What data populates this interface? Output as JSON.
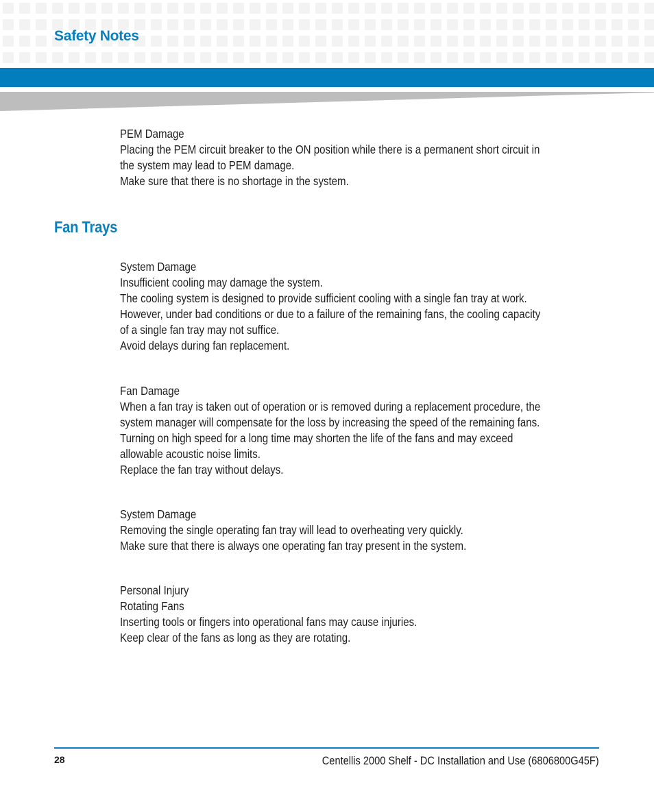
{
  "header": {
    "section_title": "Safety Notes",
    "accent_color": "#027dbd"
  },
  "pem_note": {
    "title": "PEM Damage",
    "lines": [
      "Placing the PEM circuit breaker to the ON position while there is a permanent short circuit in",
      "the system may lead to PEM damage.",
      "Make sure that there is no shortage in the system."
    ]
  },
  "fan_trays": {
    "heading": "Fan Trays",
    "notes": [
      {
        "title": "System Damage",
        "lines": [
          "Insufficient cooling may damage the system.",
          "The cooling system is designed to provide sufficient cooling with a single fan tray at work.",
          "However, under bad conditions or due to a failure of the remaining fans, the cooling capacity",
          "of a single fan tray may not suffice.",
          "Avoid delays during fan replacement."
        ]
      },
      {
        "title": "Fan Damage",
        "lines": [
          "When a fan tray is taken out of operation or is removed during a replacement procedure, the",
          "system manager will compensate for the loss by increasing the speed of the remaining fans.",
          "Turning on high speed for a long time may shorten the life of the fans and may exceed",
          "allowable acoustic noise limits.",
          "Replace the fan tray without delays."
        ]
      },
      {
        "title": "System Damage",
        "lines": [
          "Removing the single operating fan tray will lead to overheating very quickly.",
          "Make sure that there is always one operating fan tray present in the system."
        ]
      },
      {
        "title": "Personal Injury",
        "lines": [
          "Rotating Fans",
          "Inserting tools or fingers into operational fans may cause injuries.",
          "Keep clear of the fans as long as they are rotating."
        ]
      }
    ]
  },
  "footer": {
    "page_number": "28",
    "document_title": "Centellis 2000 Shelf - DC Installation and Use (6806800G45F)"
  }
}
